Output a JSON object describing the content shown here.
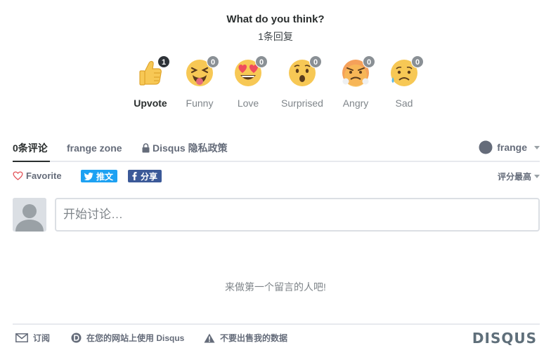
{
  "header": {
    "question": "What do you think?",
    "response_count": "1条回复"
  },
  "reactions": [
    {
      "label": "Upvote",
      "count": "1",
      "icon": "thumbs-up-icon",
      "active": true
    },
    {
      "label": "Funny",
      "count": "0",
      "icon": "laughing-face-icon",
      "active": false
    },
    {
      "label": "Love",
      "count": "0",
      "icon": "heart-eyes-face-icon",
      "active": false
    },
    {
      "label": "Surprised",
      "count": "0",
      "icon": "surprised-face-icon",
      "active": false
    },
    {
      "label": "Angry",
      "count": "0",
      "icon": "angry-face-icon",
      "active": false
    },
    {
      "label": "Sad",
      "count": "0",
      "icon": "sad-face-icon",
      "active": false
    }
  ],
  "nav": {
    "comments_tab": "0条评论",
    "community_tab": "frange zone",
    "privacy_link": "Disqus 隐私政策",
    "username": "frange"
  },
  "toolbar": {
    "favorite": "Favorite",
    "tweet": "推文",
    "share": "分享",
    "sort": "评分最高"
  },
  "composer": {
    "placeholder": "开始讨论…"
  },
  "empty_state": "来做第一个留言的人吧!",
  "footer": {
    "subscribe": "订阅",
    "add_disqus": "在您的网站上使用 Disqus",
    "do_not_sell": "不要出售我的数据",
    "brand": "DISQUS"
  },
  "colors": {
    "twitter": "#1da1f2",
    "facebook": "#3b5998",
    "emoji_yellow": "#f7c855",
    "badge_active": "#2e3338",
    "badge": "#8a9095"
  }
}
